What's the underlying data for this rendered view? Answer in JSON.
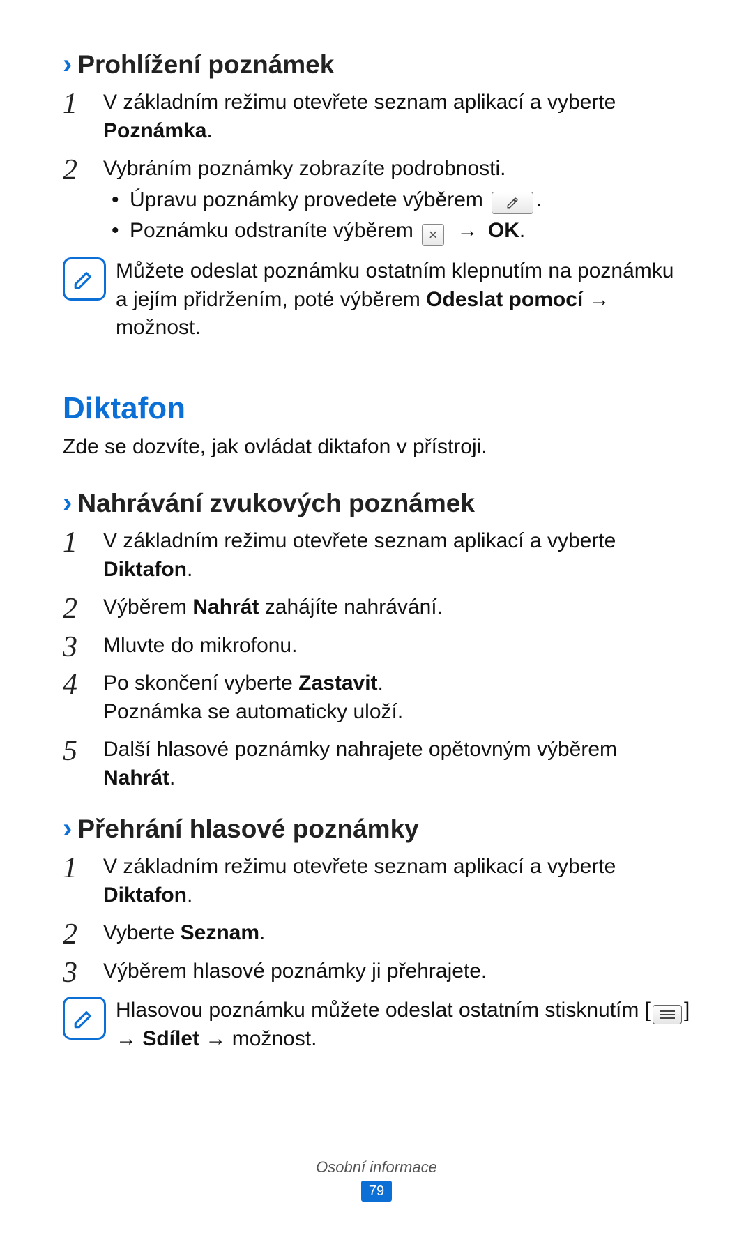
{
  "sections": {
    "view_notes": {
      "title": "Prohlížení poznámek",
      "step1_a": "V základním režimu otevřete seznam aplikací a vyberte ",
      "step1_b": "Poznámka",
      "step1_c": ".",
      "step2": "Vybráním poznámky zobrazíte podrobnosti.",
      "bullet1": "Úpravu poznámky provedete výběrem ",
      "bullet1_end": ".",
      "bullet2_a": "Poznámku odstraníte výběrem ",
      "bullet2_b": " → ",
      "bullet2_c": "OK",
      "bullet2_d": ".",
      "tip_a": "Můžete odeslat poznámku ostatním klepnutím na poznámku a jejím přidržením, poté výběrem ",
      "tip_b": "Odeslat pomocí",
      "tip_c": " → možnost."
    },
    "diktafon": {
      "title": "Diktafon",
      "lead": "Zde se dozvíte, jak ovládat diktafon v přístroji."
    },
    "record": {
      "title": "Nahrávání zvukových poznámek",
      "s1_a": "V základním režimu otevřete seznam aplikací a vyberte ",
      "s1_b": "Diktafon",
      "s1_c": ".",
      "s2_a": "Výběrem ",
      "s2_b": "Nahrát",
      "s2_c": " zahájíte nahrávání.",
      "s3": "Mluvte do mikrofonu.",
      "s4_a": "Po skončení vyberte ",
      "s4_b": "Zastavit",
      "s4_c": ".",
      "s4_d": "Poznámka se automaticky uloží.",
      "s5_a": "Další hlasové poznámky nahrajete opětovným výběrem ",
      "s5_b": "Nahrát",
      "s5_c": "."
    },
    "play": {
      "title": "Přehrání hlasové poznámky",
      "s1_a": "V základním režimu otevřete seznam aplikací a vyberte ",
      "s1_b": "Diktafon",
      "s1_c": ".",
      "s2_a": "Vyberte ",
      "s2_b": "Seznam",
      "s2_c": ".",
      "s3": "Výběrem hlasové poznámky ji přehrajete.",
      "tip_a": "Hlasovou poznámku můžete odeslat ostatním stisknutím [",
      "tip_b": "] → ",
      "tip_c": "Sdílet",
      "tip_d": " → možnost."
    }
  },
  "icons": {
    "close": "×"
  },
  "footer": {
    "section": "Osobní informace",
    "page": "79"
  }
}
